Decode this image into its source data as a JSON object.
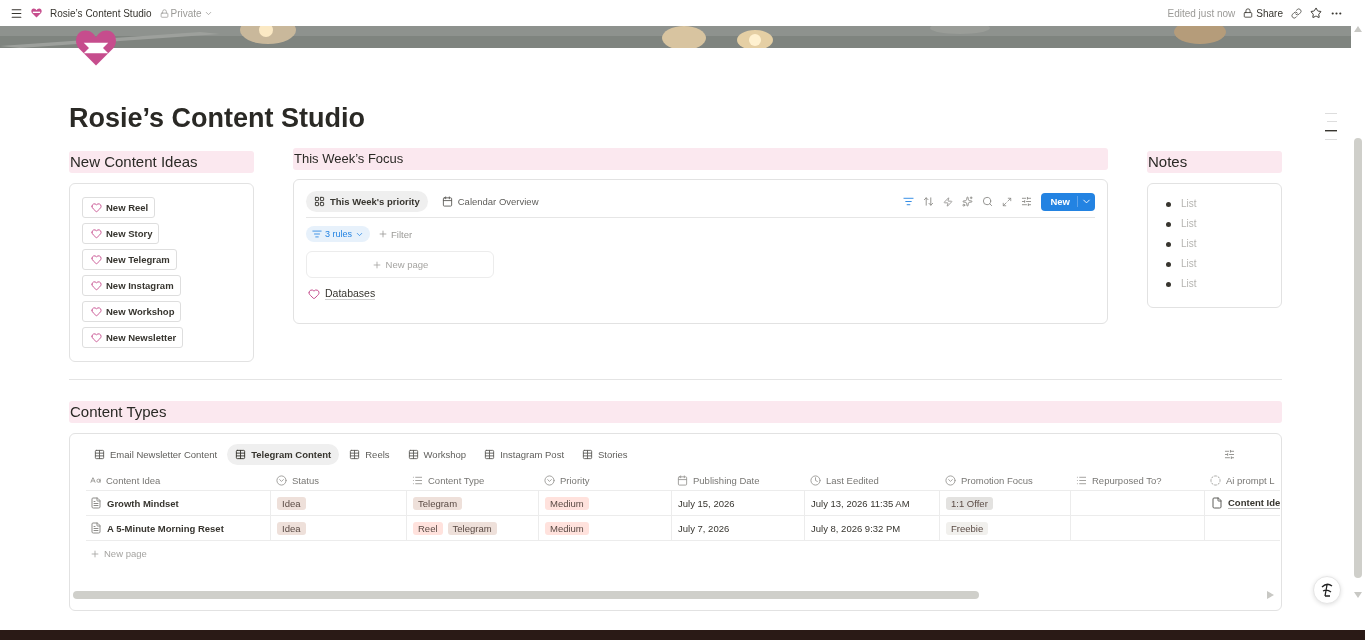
{
  "topbar": {
    "breadcrumb": "Rosie’s Content Studio",
    "privacy": "Private",
    "edited": "Edited just now",
    "share": "Share"
  },
  "page": {
    "title": "Rosie’s Content Studio"
  },
  "ideas": {
    "heading": "New Content Ideas",
    "buttons": [
      "New Reel",
      "New Story",
      "New Telegram",
      "New Instagram",
      "New Workshop",
      "New Newsletter"
    ]
  },
  "focus": {
    "heading": "This Week’s Focus",
    "tabs": [
      {
        "label": "This Week's priority",
        "kind": "board",
        "selected": true
      },
      {
        "label": "Calendar Overview",
        "kind": "calendar",
        "selected": false
      }
    ],
    "filter_active": true,
    "new_button": "New",
    "rules": "3 rules",
    "filter": "Filter",
    "new_page": "New page",
    "link": "Databases"
  },
  "notes": {
    "heading": "Notes",
    "items": [
      "List",
      "List",
      "List",
      "List",
      "List"
    ]
  },
  "content_types": {
    "heading": "Content Types",
    "tabs": [
      {
        "label": "Email Newsletter Content",
        "selected": false
      },
      {
        "label": "Telegram Content",
        "selected": true
      },
      {
        "label": "Reels",
        "selected": false
      },
      {
        "label": "Workshop",
        "selected": false
      },
      {
        "label": "Instagram Post",
        "selected": false
      },
      {
        "label": "Stories",
        "selected": false
      }
    ],
    "columns": [
      {
        "label": "Content Idea",
        "kind": "title"
      },
      {
        "label": "Status",
        "kind": "select"
      },
      {
        "label": "Content Type",
        "kind": "multi"
      },
      {
        "label": "Priority",
        "kind": "select"
      },
      {
        "label": "Publishing Date",
        "kind": "date"
      },
      {
        "label": "Last Eedited",
        "kind": "clock"
      },
      {
        "label": "Promotion Focus",
        "kind": "select"
      },
      {
        "label": "Repurposed To?",
        "kind": "multi"
      },
      {
        "label": "Ai prompt L",
        "kind": "status"
      }
    ],
    "rows": [
      {
        "cells": [
          {
            "kind": "title",
            "text": "Growth Mindset"
          },
          {
            "kind": "tags",
            "tags": [
              {
                "text": "Idea",
                "color": "#eee0da"
              }
            ]
          },
          {
            "kind": "tags",
            "tags": [
              {
                "text": "Telegram",
                "color": "#eee0da"
              }
            ]
          },
          {
            "kind": "tags",
            "tags": [
              {
                "text": "Medium",
                "color": "#ffe2dd"
              }
            ]
          },
          {
            "kind": "text",
            "text": "July 15, 2026"
          },
          {
            "kind": "text",
            "text": "July 13, 2026 11:35 AM"
          },
          {
            "kind": "tags",
            "tags": [
              {
                "text": "1:1 Offer",
                "color": "#e3e2e0"
              }
            ]
          },
          {
            "kind": "empty"
          },
          {
            "kind": "link",
            "text": "Content Ide"
          }
        ]
      },
      {
        "cells": [
          {
            "kind": "title",
            "text": "A 5-Minute Morning Reset"
          },
          {
            "kind": "tags",
            "tags": [
              {
                "text": "Idea",
                "color": "#eee0da"
              }
            ]
          },
          {
            "kind": "tags",
            "tags": [
              {
                "text": "Reel",
                "color": "#ffe2dd"
              },
              {
                "text": "Telegram",
                "color": "#eee0da"
              }
            ]
          },
          {
            "kind": "tags",
            "tags": [
              {
                "text": "Medium",
                "color": "#ffe2dd"
              }
            ]
          },
          {
            "kind": "text",
            "text": "July 7, 2026"
          },
          {
            "kind": "text",
            "text": "July 8, 2026 9:32 PM"
          },
          {
            "kind": "tags",
            "tags": [
              {
                "text": "Freebie",
                "color": "#f1f0ed"
              }
            ]
          },
          {
            "kind": "empty"
          },
          {
            "kind": "empty"
          }
        ]
      }
    ],
    "new_page": "New page"
  }
}
